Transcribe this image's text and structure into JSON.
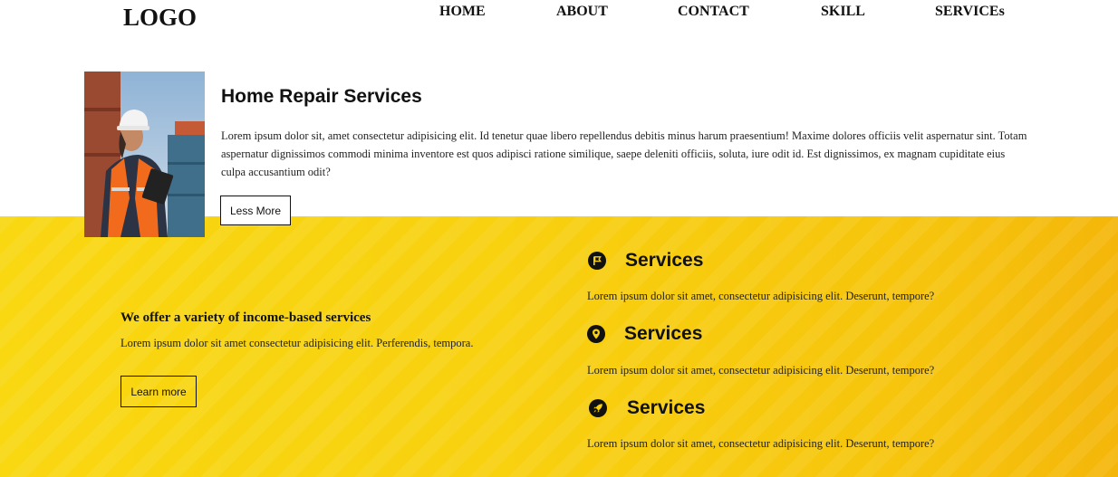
{
  "header": {
    "logo": "LOGO",
    "nav": [
      "HOME",
      "ABOUT",
      "CONTACT",
      "SKILL",
      "SERVICEs"
    ]
  },
  "hero": {
    "title": "Home Repair Services",
    "text": "Lorem ipsum dolor sit, amet consectetur adipisicing elit. Id tenetur quae libero repellendus debitis minus harum praesentium! Maxime dolores officiis velit aspernatur sint. Totam aspernatur dignissimos commodi minima inventore est quos adipisci ratione similique, saepe deleniti officiis, soluta, iure odit id. Est dignissimos, ex magnam cupiditate eius culpa accusantium odit?",
    "button": "Less More"
  },
  "offer": {
    "title": "We offer a variety of income-based services",
    "text": "Lorem ipsum dolor sit amet consectetur adipisicing elit. Perferendis, tempora.",
    "button": "Learn more"
  },
  "services": [
    {
      "icon": "flag-icon",
      "title": "Services",
      "text": "Lorem ipsum dolor sit amet, consectetur adipisicing elit. Deserunt, tempore?"
    },
    {
      "icon": "map-marker-icon",
      "title": "Services",
      "text": "Lorem ipsum dolor sit amet, consectetur adipisicing elit. Deserunt, tempore?"
    },
    {
      "icon": "rocket-icon",
      "title": "Services",
      "text": "Lorem ipsum dolor sit amet, consectetur adipisicing elit. Deserunt, tempore?"
    }
  ],
  "colors": {
    "accent_yellow": "#f8d10f",
    "text": "#111111"
  }
}
